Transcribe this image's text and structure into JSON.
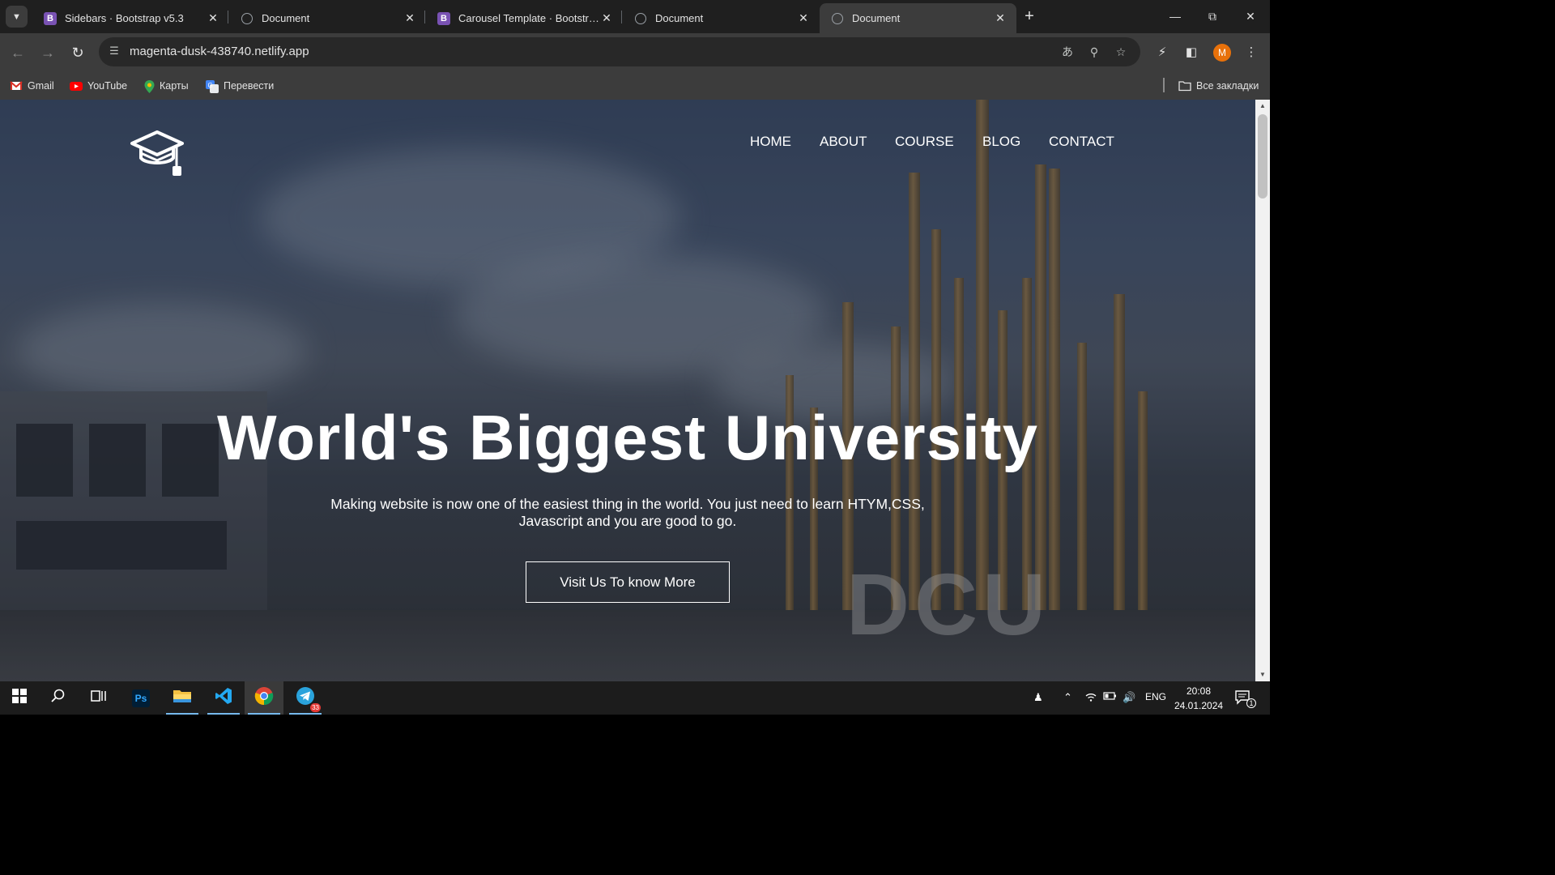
{
  "browser": {
    "tabs": [
      {
        "title": "Sidebars · Bootstrap v5.3",
        "favicon": "bootstrap-icon",
        "active": false
      },
      {
        "title": "Document",
        "favicon": "globe-icon",
        "active": false
      },
      {
        "title": "Carousel Template · Bootstrap v5.3",
        "favicon": "bootstrap-icon",
        "active": false
      },
      {
        "title": "Document",
        "favicon": "globe-icon",
        "active": false
      },
      {
        "title": "Document",
        "favicon": "globe-icon",
        "active": true
      }
    ],
    "url": "magenta-dusk-438740.netlify.app",
    "avatar_initial": "M",
    "bookmarks": [
      {
        "label": "Gmail",
        "icon": "gmail-icon"
      },
      {
        "label": "YouTube",
        "icon": "youtube-icon"
      },
      {
        "label": "Карты",
        "icon": "maps-icon"
      },
      {
        "label": "Перевести",
        "icon": "translate-icon"
      }
    ],
    "all_bookmarks_label": "Все закладки"
  },
  "site": {
    "nav": [
      "HOME",
      "ABOUT",
      "COURSE",
      "BLOG",
      "CONTACT"
    ],
    "hero": {
      "title": "World's Biggest University",
      "subtitle": "Making website is now one of the easiest thing in the world. You just need to learn HTYM,CSS, Javascript and you are good to go.",
      "button": "Visit Us To know More"
    },
    "background_sign": "DCU"
  },
  "taskbar": {
    "language": "ENG",
    "time": "20:08",
    "date": "24.01.2024",
    "notification_count": "1",
    "telegram_badge": "33"
  },
  "colors": {
    "tab_bar": "#1f1f1f",
    "toolbar": "#3c3c3c",
    "accent_avatar": "#e8710a",
    "bootstrap_purple": "#7952b3"
  }
}
